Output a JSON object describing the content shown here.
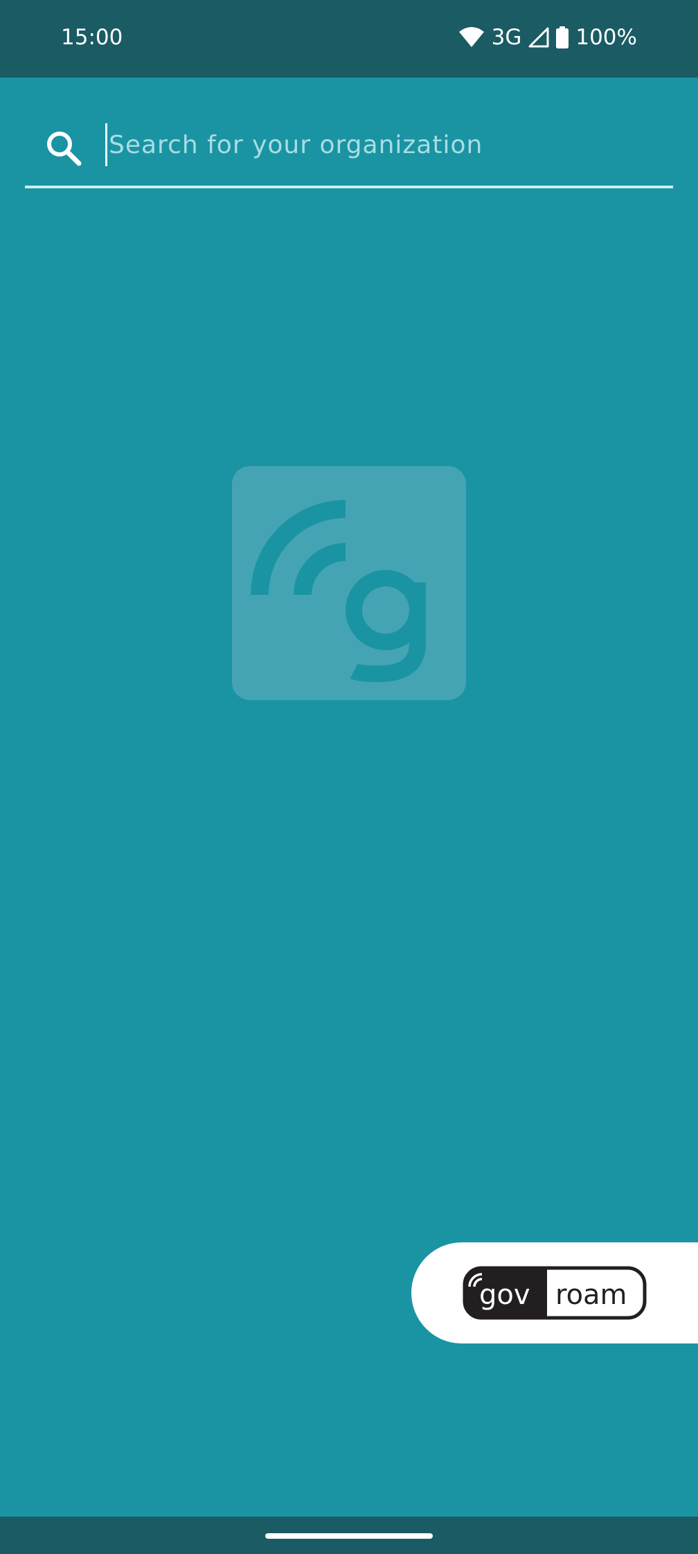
{
  "status_bar": {
    "time": "15:00",
    "network": "3G",
    "battery": "100%"
  },
  "search": {
    "placeholder": "Search for your organization",
    "value": ""
  },
  "brand": {
    "logo_text_left": "gov",
    "logo_text_right": "roam"
  },
  "colors": {
    "background": "#1a94a3",
    "status_bar": "#1a5b64",
    "underline": "#c9f0f4",
    "placeholder": "#a9dde4"
  },
  "icons": {
    "search": "search-icon",
    "wifi": "wifi-icon",
    "signal": "signal-icon",
    "battery": "battery-icon"
  }
}
